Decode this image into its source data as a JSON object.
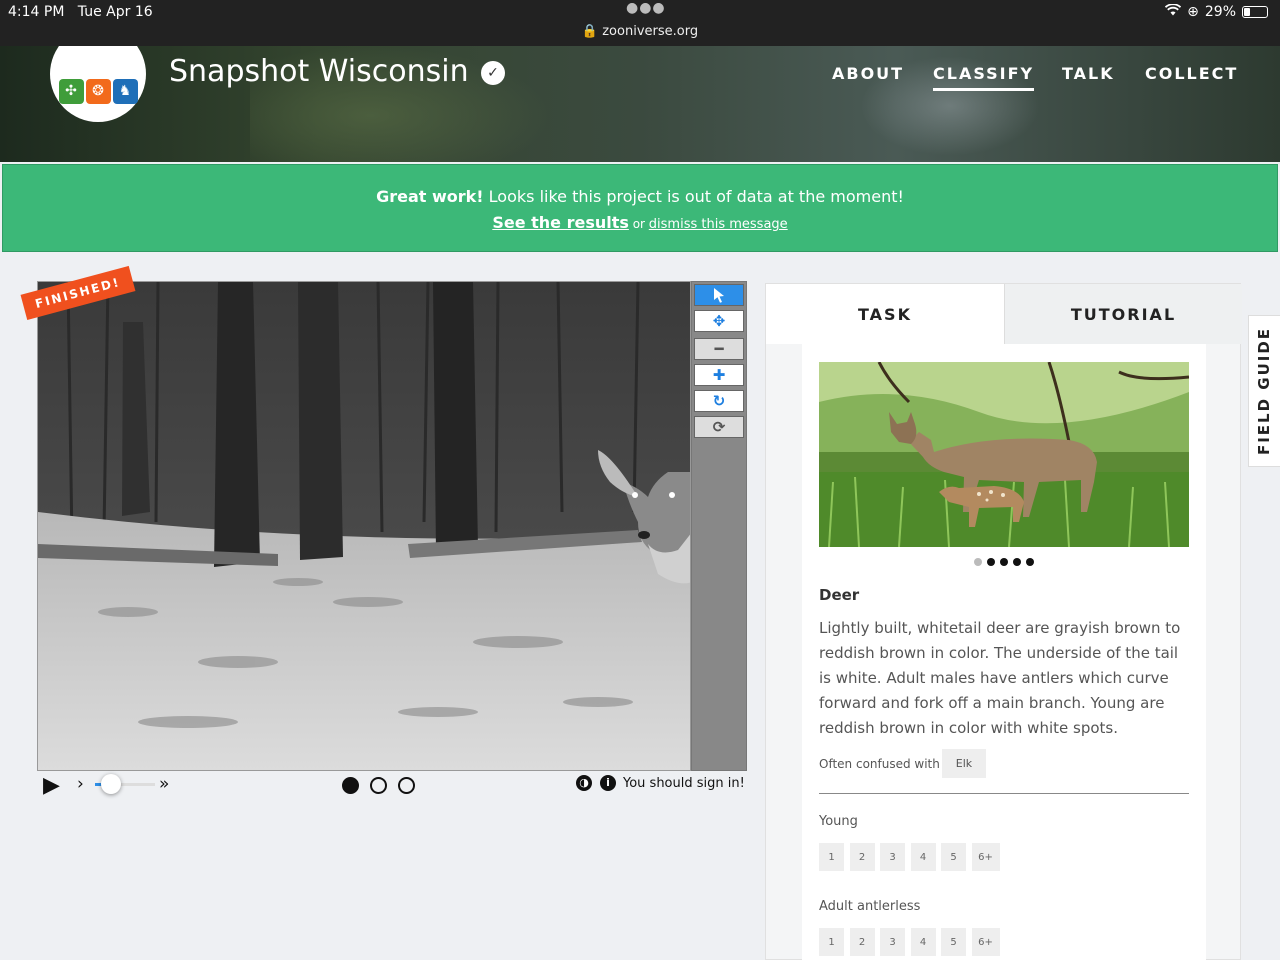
{
  "status_bar": {
    "time": "4:14 PM",
    "date": "Tue Apr 16",
    "url": "zooniverse.org",
    "battery": "29%",
    "battery_level": 0.29
  },
  "header": {
    "project_title": "Snapshot Wisconsin",
    "nav": [
      {
        "label": "ABOUT",
        "active": false
      },
      {
        "label": "CLASSIFY",
        "active": true
      },
      {
        "label": "TALK",
        "active": false
      },
      {
        "label": "COLLECT",
        "active": false
      }
    ],
    "logo_colors": [
      "#3f9d3a",
      "#f26a1b",
      "#1f6fb8"
    ]
  },
  "banner": {
    "bold": "Great work!",
    "message": " Looks like this project is out of data at the moment!",
    "results_link": "See the results",
    "or": " or ",
    "dismiss_link": "dismiss this message"
  },
  "subject": {
    "ribbon": "FINISHED!",
    "frames_total": 3,
    "current_frame": 1,
    "sign_in": "You should sign in!"
  },
  "panel": {
    "tabs": [
      {
        "label": "TASK",
        "active": true
      },
      {
        "label": "TUTORIAL",
        "active": false
      }
    ],
    "species": {
      "name": "Deer",
      "description": "Lightly built, whitetail deer are grayish brown to reddish brown in color. The underside of the tail is white. Adult males have antlers which curve forward and fork off a main branch. Young are reddish brown in color with white spots.",
      "confused_label": "Often confused with",
      "confused_with": "Elk",
      "photo_count": 5,
      "photo_index": 1
    },
    "questions": [
      {
        "label": "Young",
        "options": [
          "1",
          "2",
          "3",
          "4",
          "5",
          "6+"
        ]
      },
      {
        "label": "Adult antlerless",
        "options": [
          "1",
          "2",
          "3",
          "4",
          "5",
          "6+"
        ]
      }
    ]
  },
  "field_guide": "FIELD GUIDE",
  "colors": {
    "banner": "#3cb878",
    "accent": "#2d8fe8",
    "ribbon": "#f0501e"
  }
}
